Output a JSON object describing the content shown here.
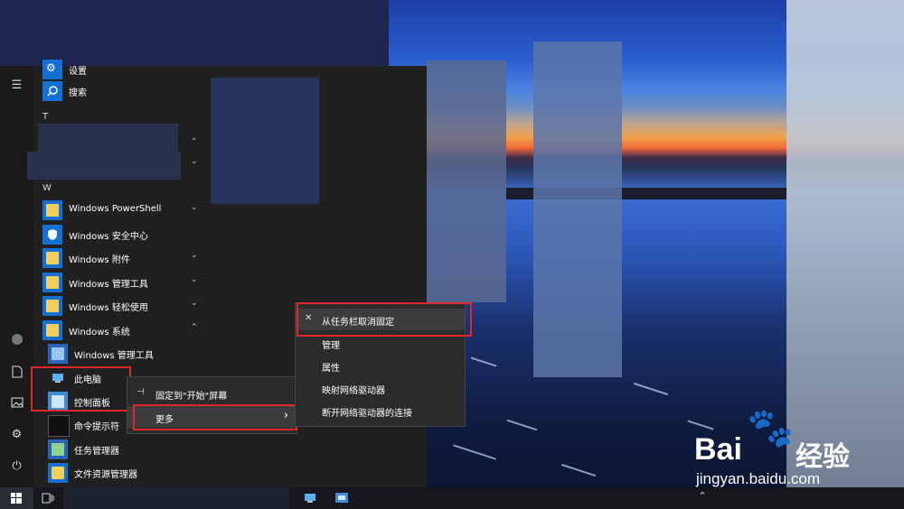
{
  "start_menu": {
    "letters": {
      "t": "T",
      "w": "W"
    },
    "top_items": [
      {
        "label": "设置"
      },
      {
        "label": "搜索"
      }
    ],
    "apps": [
      {
        "label": "Windows PowerShell",
        "chevron": "⌄"
      },
      {
        "label": "Windows 安全中心",
        "chevron": ""
      },
      {
        "label": "Windows 附件",
        "chevron": "⌄"
      },
      {
        "label": "Windows 管理工具",
        "chevron": "⌄"
      },
      {
        "label": "Windows 轻松使用",
        "chevron": "⌄"
      },
      {
        "label": "Windows 系统",
        "chevron": "⌃"
      }
    ],
    "system_apps": [
      {
        "label": "Windows 管理工具"
      },
      {
        "label": "此电脑"
      },
      {
        "label": "控制面板"
      },
      {
        "label": "命令提示符"
      },
      {
        "label": "任务管理器"
      },
      {
        "label": "文件资源管理器"
      }
    ]
  },
  "context_menu": {
    "pin_start": "固定到\"开始\"屏幕",
    "more": "更多",
    "more_arrow": "›"
  },
  "submenu": {
    "items": [
      {
        "label": "从任务栏取消固定"
      },
      {
        "label": "管理"
      },
      {
        "label": "属性"
      },
      {
        "label": "映射网络驱动器"
      },
      {
        "label": "断开网络驱动器的连接"
      }
    ]
  },
  "watermark": {
    "brand": "Bai",
    "brand_tail": "经验",
    "url": "jingyan.baidu.com"
  },
  "colors": {
    "accent": "#1570d6",
    "highlight": "#e0262a",
    "menu_bg": "#202020"
  },
  "icons": [
    "hamburger-icon",
    "settings-icon",
    "search-icon",
    "user-icon",
    "document-icon",
    "pictures-icon",
    "gear-icon",
    "power-icon",
    "windows-logo-icon",
    "task-view-icon",
    "this-pc-icon",
    "control-panel-icon",
    "chevron-up-icon"
  ]
}
